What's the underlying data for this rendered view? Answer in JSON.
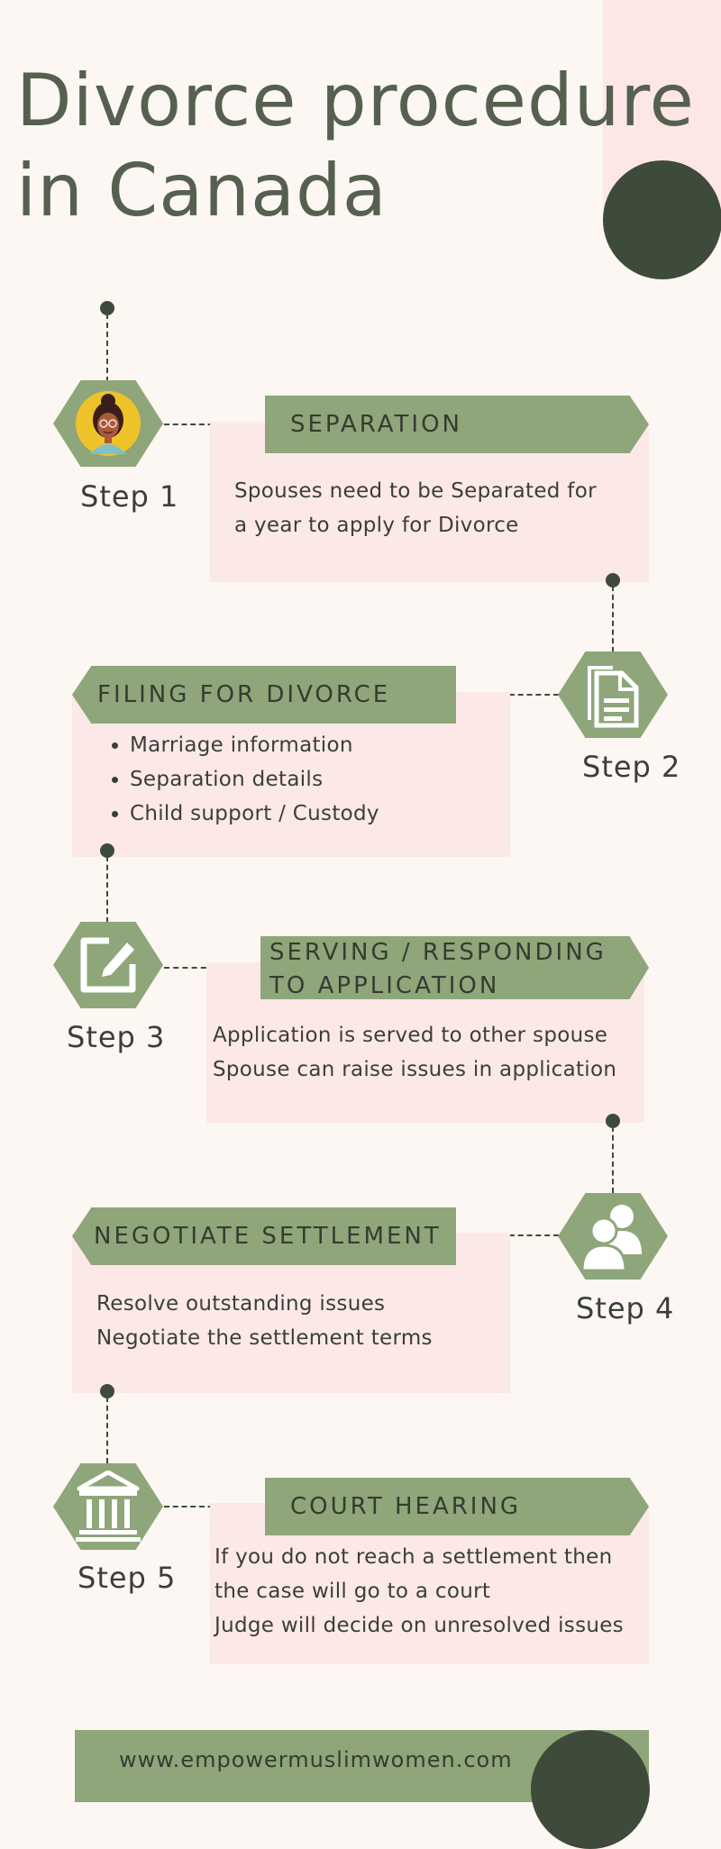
{
  "title_line1": "Divorce procedure",
  "title_line2": "in Canada",
  "steps": [
    {
      "label": "Step 1",
      "heading": "SEPARATION",
      "icon": "woman-avatar-icon",
      "lines": [
        "Spouses need to be Separated for",
        "a year to apply for Divorce"
      ]
    },
    {
      "label": "Step 2",
      "heading": "FILING FOR DIVORCE",
      "icon": "documents-icon",
      "bullets": [
        "Marriage information",
        "Separation details",
        "Child support / Custody"
      ]
    },
    {
      "label": "Step 3",
      "heading_line1": "SERVING / RESPONDING",
      "heading_line2": "TO APPLICATION",
      "icon": "edit-icon",
      "lines": [
        "Application is served to other spouse",
        "Spouse can raise issues in application"
      ]
    },
    {
      "label": "Step 4",
      "heading": "NEGOTIATE SETTLEMENT",
      "icon": "people-icon",
      "lines": [
        "Resolve outstanding issues",
        "Negotiate the settlement terms"
      ]
    },
    {
      "label": "Step 5",
      "heading": "COURT HEARING",
      "icon": "courthouse-icon",
      "lines": [
        "If you do not reach a settlement then",
        "the case will go to a court",
        "Judge will decide on unresolved issues"
      ]
    }
  ],
  "footer_url": "www.empowermuslimwomen.com",
  "colors": {
    "background": "#fcf7f2",
    "green": "#8ea67a",
    "dark": "#3e4a3a",
    "pink": "#fde8e8",
    "title": "#56604f"
  }
}
